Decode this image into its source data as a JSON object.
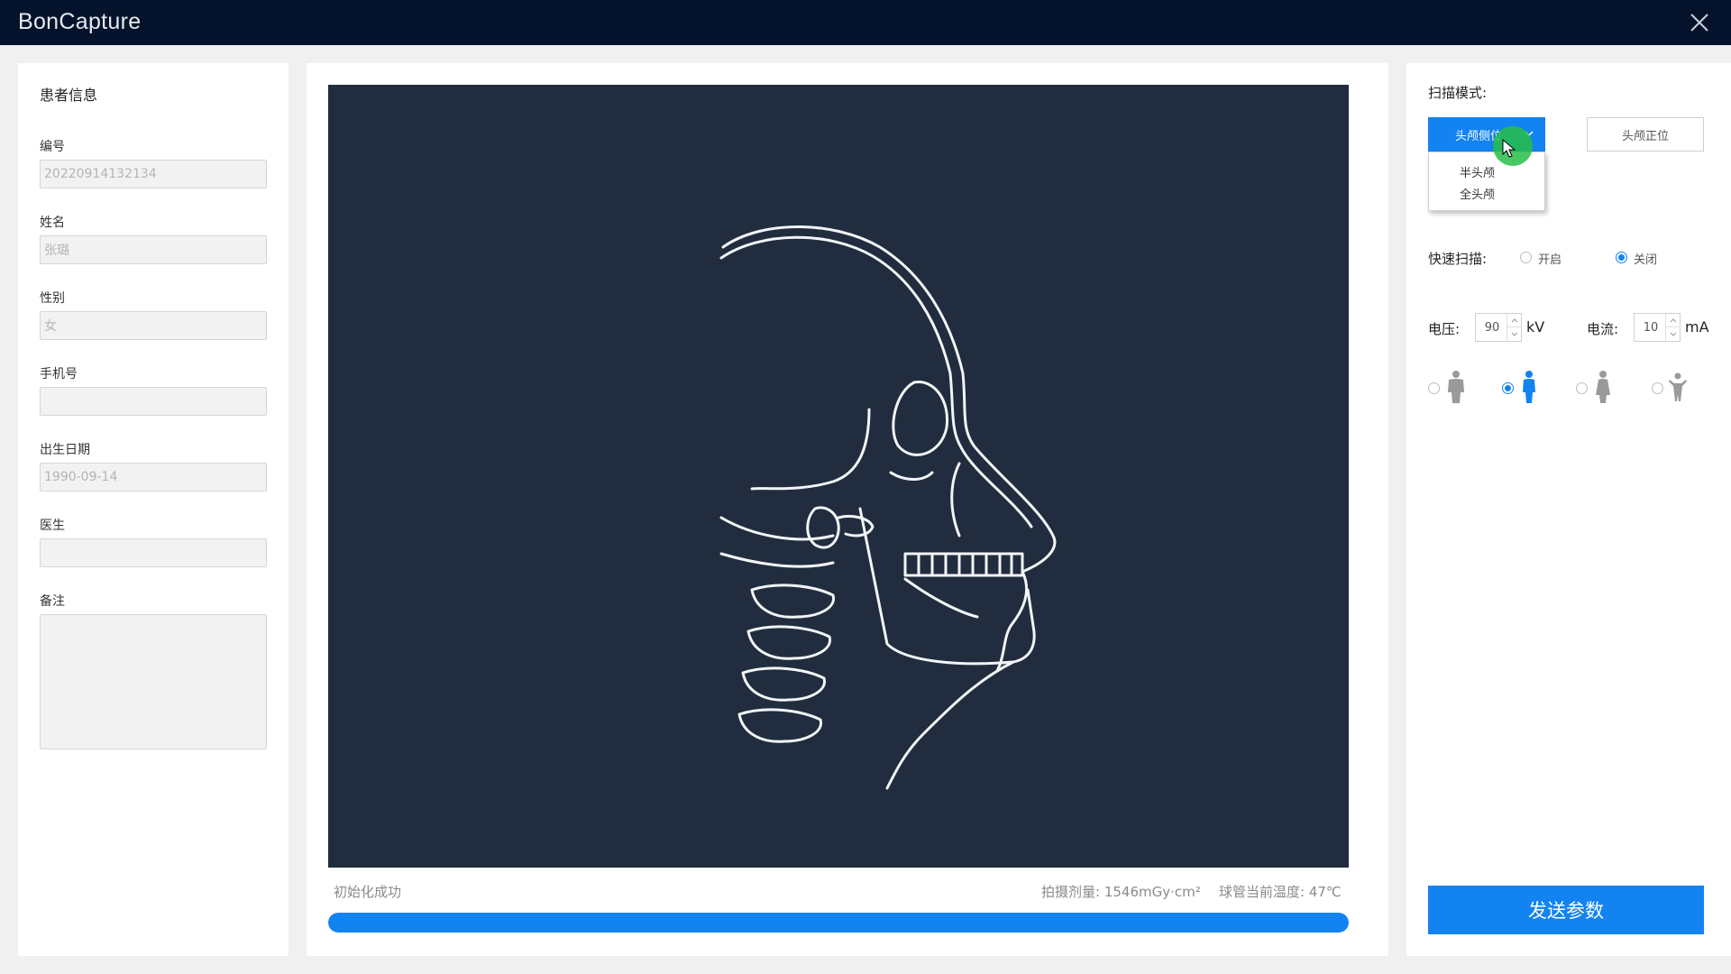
{
  "app": {
    "title": "BonCapture"
  },
  "patient": {
    "heading": "患者信息",
    "id_label": "编号",
    "id_value": "20220914132134",
    "name_label": "姓名",
    "name_value": "张璐",
    "gender_label": "性别",
    "gender_value": "女",
    "phone_label": "手机号",
    "phone_value": "",
    "birth_label": "出生日期",
    "birth_value": "1990-09-14",
    "doctor_label": "医生",
    "doctor_value": "",
    "notes_label": "备注",
    "notes_value": ""
  },
  "viewer": {
    "status": "初始化成功",
    "dose_text": "拍摄剂量: 1546mGy·cm²",
    "temp_text": "球管当前温度: 47℃",
    "progress": 1.0
  },
  "scan": {
    "mode_label": "扫描模式:",
    "mode_active": "头颅侧位",
    "mode_other": "头颅正位",
    "mode_options": [
      "半头颅",
      "全头颅"
    ],
    "fast_label": "快速扫描:",
    "fast_on": "开启",
    "fast_off": "关闭",
    "fast_selected": "关闭",
    "voltage_label": "电压:",
    "voltage_value": "90",
    "voltage_unit": "kV",
    "current_label": "电流:",
    "current_value": "10",
    "current_unit": "mA",
    "body_type_selected": 1,
    "send_label": "发送参数"
  },
  "colors": {
    "accent": "#1283f0",
    "titlebar": "#04132b",
    "viewer_bg": "#212d3e"
  }
}
